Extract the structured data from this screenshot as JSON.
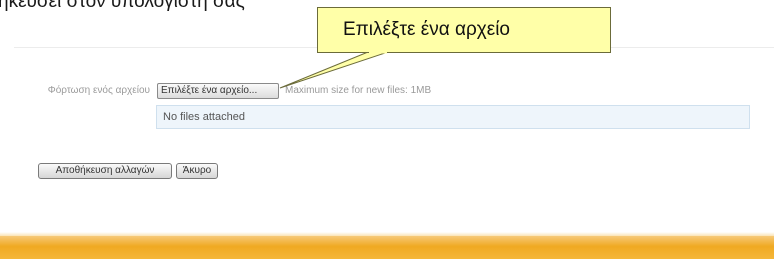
{
  "heading": {
    "text": "ηκεύσει στον υπολογιστή σας"
  },
  "callout": {
    "text": "Επιλέξτε ένα αρχείο"
  },
  "upload": {
    "label": "Φόρτωση ενός αρχείου",
    "choose_button": "Επιλέξτε ένα αρχείο...",
    "max_size": "Maximum size for new files: 1MB",
    "attached_status": "No files attached"
  },
  "actions": {
    "save_label": "Αποθήκευση αλλαγών",
    "cancel_label": "Άκυρο"
  },
  "colors": {
    "callout_bg": "#ffffa8",
    "files_box_bg": "#eef5fb",
    "bottom_bar": "#f0a922"
  }
}
